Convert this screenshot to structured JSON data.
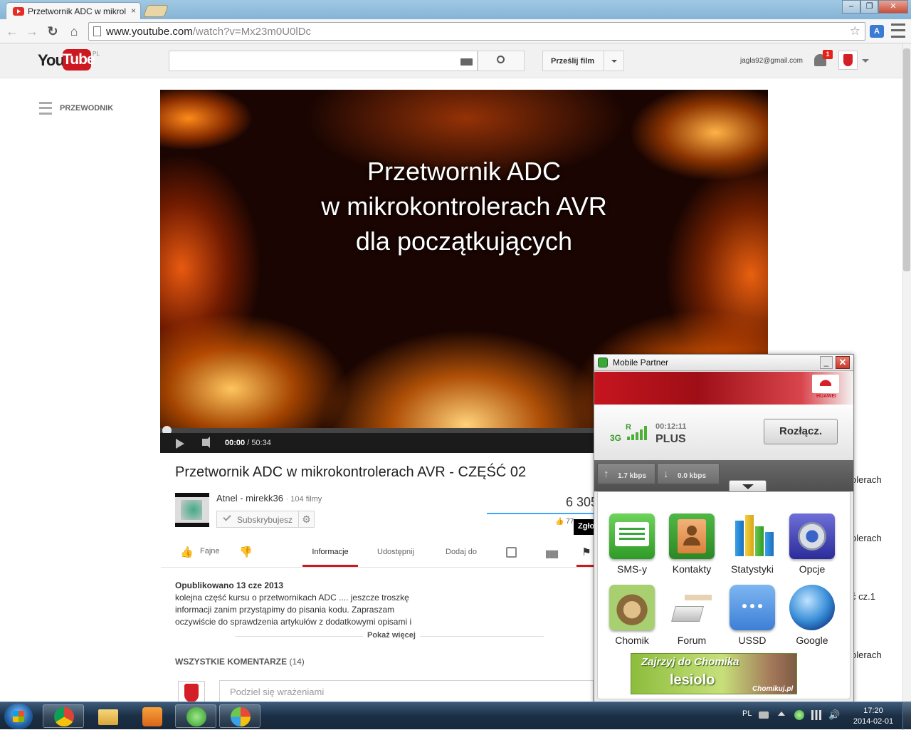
{
  "browser": {
    "tab_title": "Przetwornik ADC w mikrol",
    "tab_close": "×",
    "url_host": "www.youtube.com",
    "url_path": "/watch?v=Mx23m0U0lDc",
    "controls": {
      "minimize": "‒",
      "restore": "❐",
      "close": "✕"
    }
  },
  "youtube": {
    "logo_you": "You",
    "logo_tube": "Tube",
    "logo_region": "PL",
    "search_placeholder": "",
    "upload_label": "Prześlij film",
    "account_email": "jagla92@gmail.com",
    "notification_count": "1",
    "guide_label": "PRZEWODNIK"
  },
  "video": {
    "overlay_lines": [
      "Przetwornik ADC",
      "w mikrokontrolerach AVR",
      "dla początkujących"
    ],
    "progress": 0.0,
    "current_time": "00:00",
    "duration": "/ 50:34"
  },
  "watch": {
    "title": "Przetwornik ADC w mikrokontrolerach AVR - CZĘŚĆ 02",
    "channel_name": "Atnel - mirekk36",
    "channel_videos": "104 filmy",
    "subscribe_label": "Subskrybujesz",
    "views": "6 305",
    "likes_partial": "77",
    "report_tooltip": "Zgłoś",
    "like_label": "Fajne",
    "tabs": [
      "Informacje",
      "Udostępnij",
      "Dodaj do"
    ],
    "published": "Opublikowano 13 cze 2013",
    "description_lines": [
      "kolejna część kursu o przetwornikach ADC .... jeszcze troszkę",
      "informacji zanim przystąpimy do pisania kodu. Zapraszam",
      "oczywiście do sprawdzenia artykułów z dodatkowymi opisami i"
    ],
    "show_more": "Pokaż więcej",
    "comments_label": "WSZYSTKIE KOMENTARZE",
    "comments_count": "(14)",
    "comment_placeholder": "Podziel się wrażeniami"
  },
  "recommended_partial": [
    "olerach",
    "olerach",
    "ć cz.1",
    "olerach"
  ],
  "mobile_partner": {
    "title": "Mobile Partner",
    "brand": "HUAWEI",
    "network_type": "3G",
    "roaming_flag": "R",
    "signal_bars": 5,
    "connected_time": "00:12:11",
    "operator": "PLUS",
    "disconnect_label": "Rozłącz.",
    "upload_speed": "1.7 kbps",
    "download_speed": "0.0 kbps",
    "apps": [
      {
        "label": "SMS-y",
        "icon": "sms-icon",
        "color": "#3aa63a"
      },
      {
        "label": "Kontakty",
        "icon": "contacts-icon",
        "color": "#e08a3a"
      },
      {
        "label": "Statystyki",
        "icon": "statistics-icon",
        "color": "#4aa0e0"
      },
      {
        "label": "Opcje",
        "icon": "options-icon",
        "color": "#3a5fd0"
      },
      {
        "label": "Chomik",
        "icon": "chomik-icon",
        "color": "#8a6a3a"
      },
      {
        "label": "Forum",
        "icon": "forum-icon",
        "color": "#dddddd"
      },
      {
        "label": "USSD",
        "icon": "ussd-icon",
        "color": "#4a8ee6"
      },
      {
        "label": "Google",
        "icon": "google-icon",
        "color": "#3a8fd8"
      }
    ],
    "banner": {
      "line1": "Zajrzyj do Chomika",
      "line2": "lesiolo",
      "line3": "Chomikuj.pl"
    }
  },
  "taskbar": {
    "language": "PL",
    "time": "17:20",
    "date": "2014-02-01",
    "apps": [
      "chrome-icon",
      "explorer-icon",
      "media-player-icon",
      "mobile-partner-icon",
      "paint-icon"
    ]
  }
}
